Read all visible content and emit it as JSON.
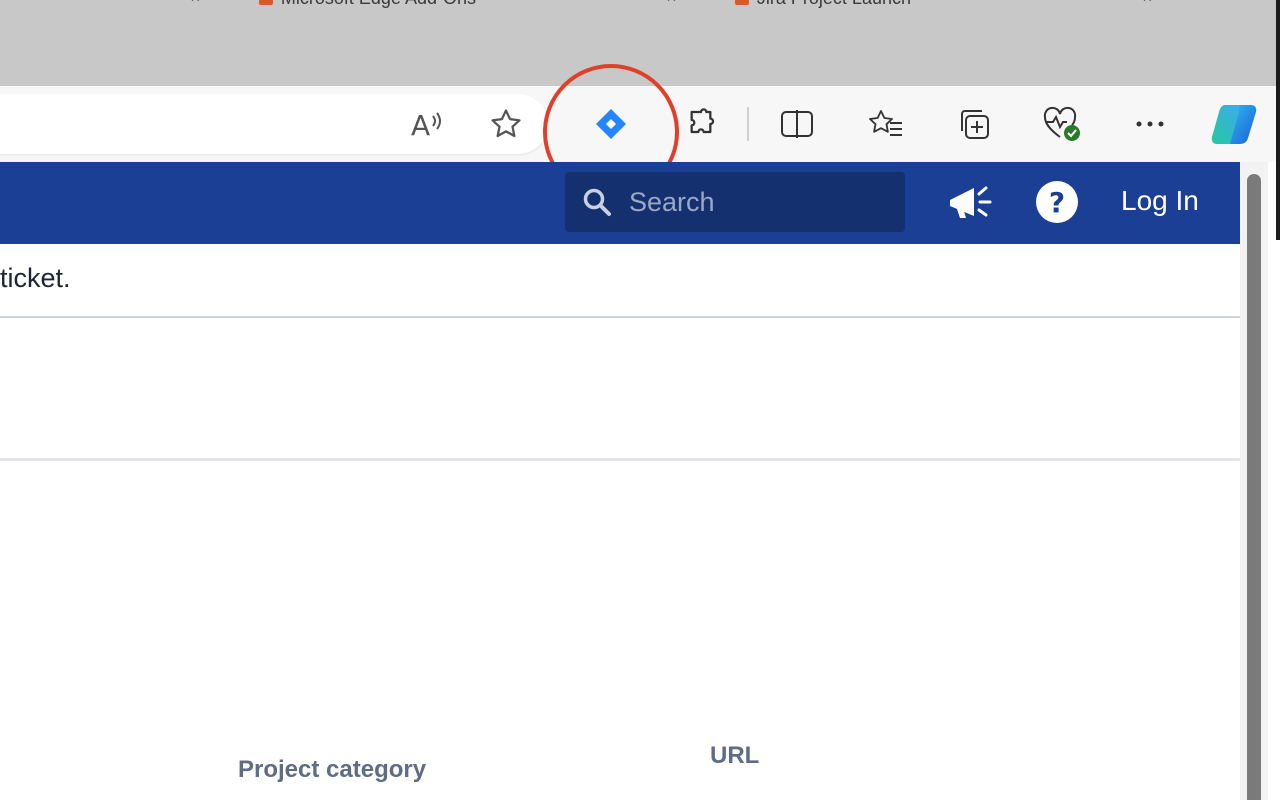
{
  "browser": {
    "tabs_partial": [
      {
        "title": "Microsoft Edge Add-Ons"
      },
      {
        "title": "Jira Project Launch"
      }
    ],
    "toolbar": {
      "read_aloud": "read-aloud-icon",
      "favorite": "star-icon",
      "jira_extension": "jira-icon",
      "extensions": "puzzle-icon",
      "split_screen": "split-screen-icon",
      "favorites": "favorites-icon",
      "collections": "collections-icon",
      "browser_essentials": "heartbeat-icon",
      "more": "more-icon",
      "copilot": "copilot-icon"
    },
    "highlight_color": "#e0402a"
  },
  "app_header": {
    "bg_color": "#1a3f95",
    "search_placeholder": "Search",
    "login_label": "Log In"
  },
  "content": {
    "ticket_text": "ticket.",
    "columns": {
      "project_category": "Project category",
      "url": "URL"
    }
  }
}
